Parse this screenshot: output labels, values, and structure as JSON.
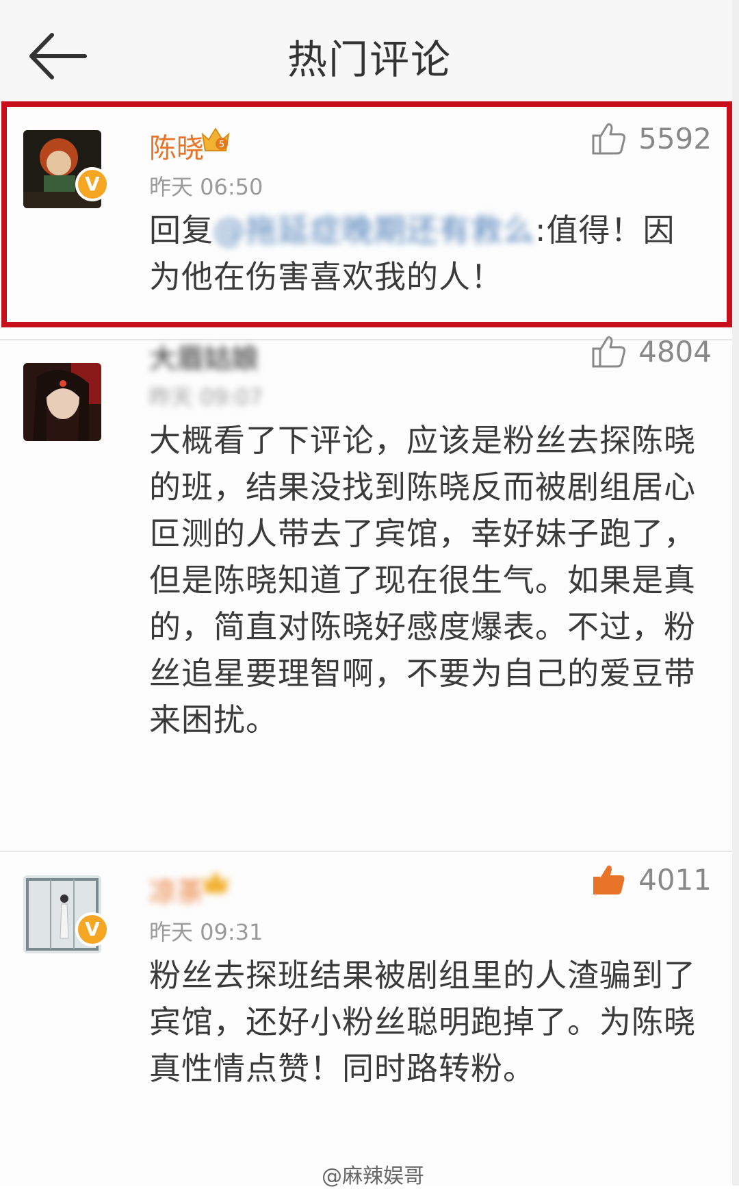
{
  "header": {
    "title": "热门评论"
  },
  "comments": [
    {
      "username": "陈晓",
      "verified": true,
      "time": "昨天 06:50",
      "likes": "5592",
      "reply_prefix": "回复",
      "mention": "@拖延症晚期还有救么",
      "reply_sep": ":",
      "text": "值得！因为他在伤害喜欢我的人！"
    },
    {
      "username": "大眉姑娘",
      "verified": false,
      "time": "昨天 09:07",
      "likes": "4804",
      "text": "大概看了下评论，应该是粉丝去探陈晓的班，结果没找到陈晓反而被剧组居心叵测的人带去了宾馆，幸好妹子跑了，但是陈晓知道了现在很生气。如果是真的，简直对陈晓好感度爆表。不过，粉丝追星要理智啊，不要为自己的爱豆带来困扰。"
    },
    {
      "username": "凉茶",
      "verified": true,
      "time": "昨天 09:31",
      "likes": "4011",
      "text": "粉丝去探班结果被剧组里的人渣骗到了宾馆，还好小粉丝聪明跑掉了。为陈晓真性情点赞！同时路转粉。"
    }
  ],
  "watermark": "@麻辣娱哥",
  "colors": {
    "highlight_border": "#c8101d",
    "username_orange": "#e8742a",
    "mention_blue": "#4e7fb8",
    "verified_badge": "#f5a623"
  }
}
